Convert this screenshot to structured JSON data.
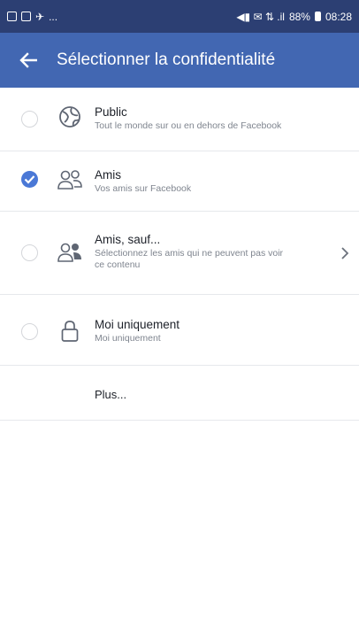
{
  "status_bar": {
    "left_glyph": "✈",
    "ellipsis": "...",
    "right_icons_text": "◀▮ ✉ ⇅ .il",
    "battery": "88%",
    "time": "08:28"
  },
  "app_bar": {
    "title": "Sélectionner la confidentialité"
  },
  "options": [
    {
      "title": "Public",
      "subtitle": "Tout le monde sur ou en dehors de Facebook",
      "icon": "globe-icon",
      "selected": false
    },
    {
      "title": "Amis",
      "subtitle": "Vos amis sur Facebook",
      "icon": "friends-icon",
      "selected": true
    },
    {
      "title": "Amis, sauf...",
      "subtitle": "Sélectionnez les amis qui ne peuvent pas voir ce contenu",
      "icon": "friends-except-icon",
      "selected": false
    },
    {
      "title": "Moi uniquement",
      "subtitle": "Moi uniquement",
      "icon": "lock-icon",
      "selected": false
    }
  ],
  "more": {
    "label": "Plus..."
  },
  "colors": {
    "status_bar": "#2c3f73",
    "app_bar": "#4267b2",
    "selected_radio": "#4a78d6"
  }
}
